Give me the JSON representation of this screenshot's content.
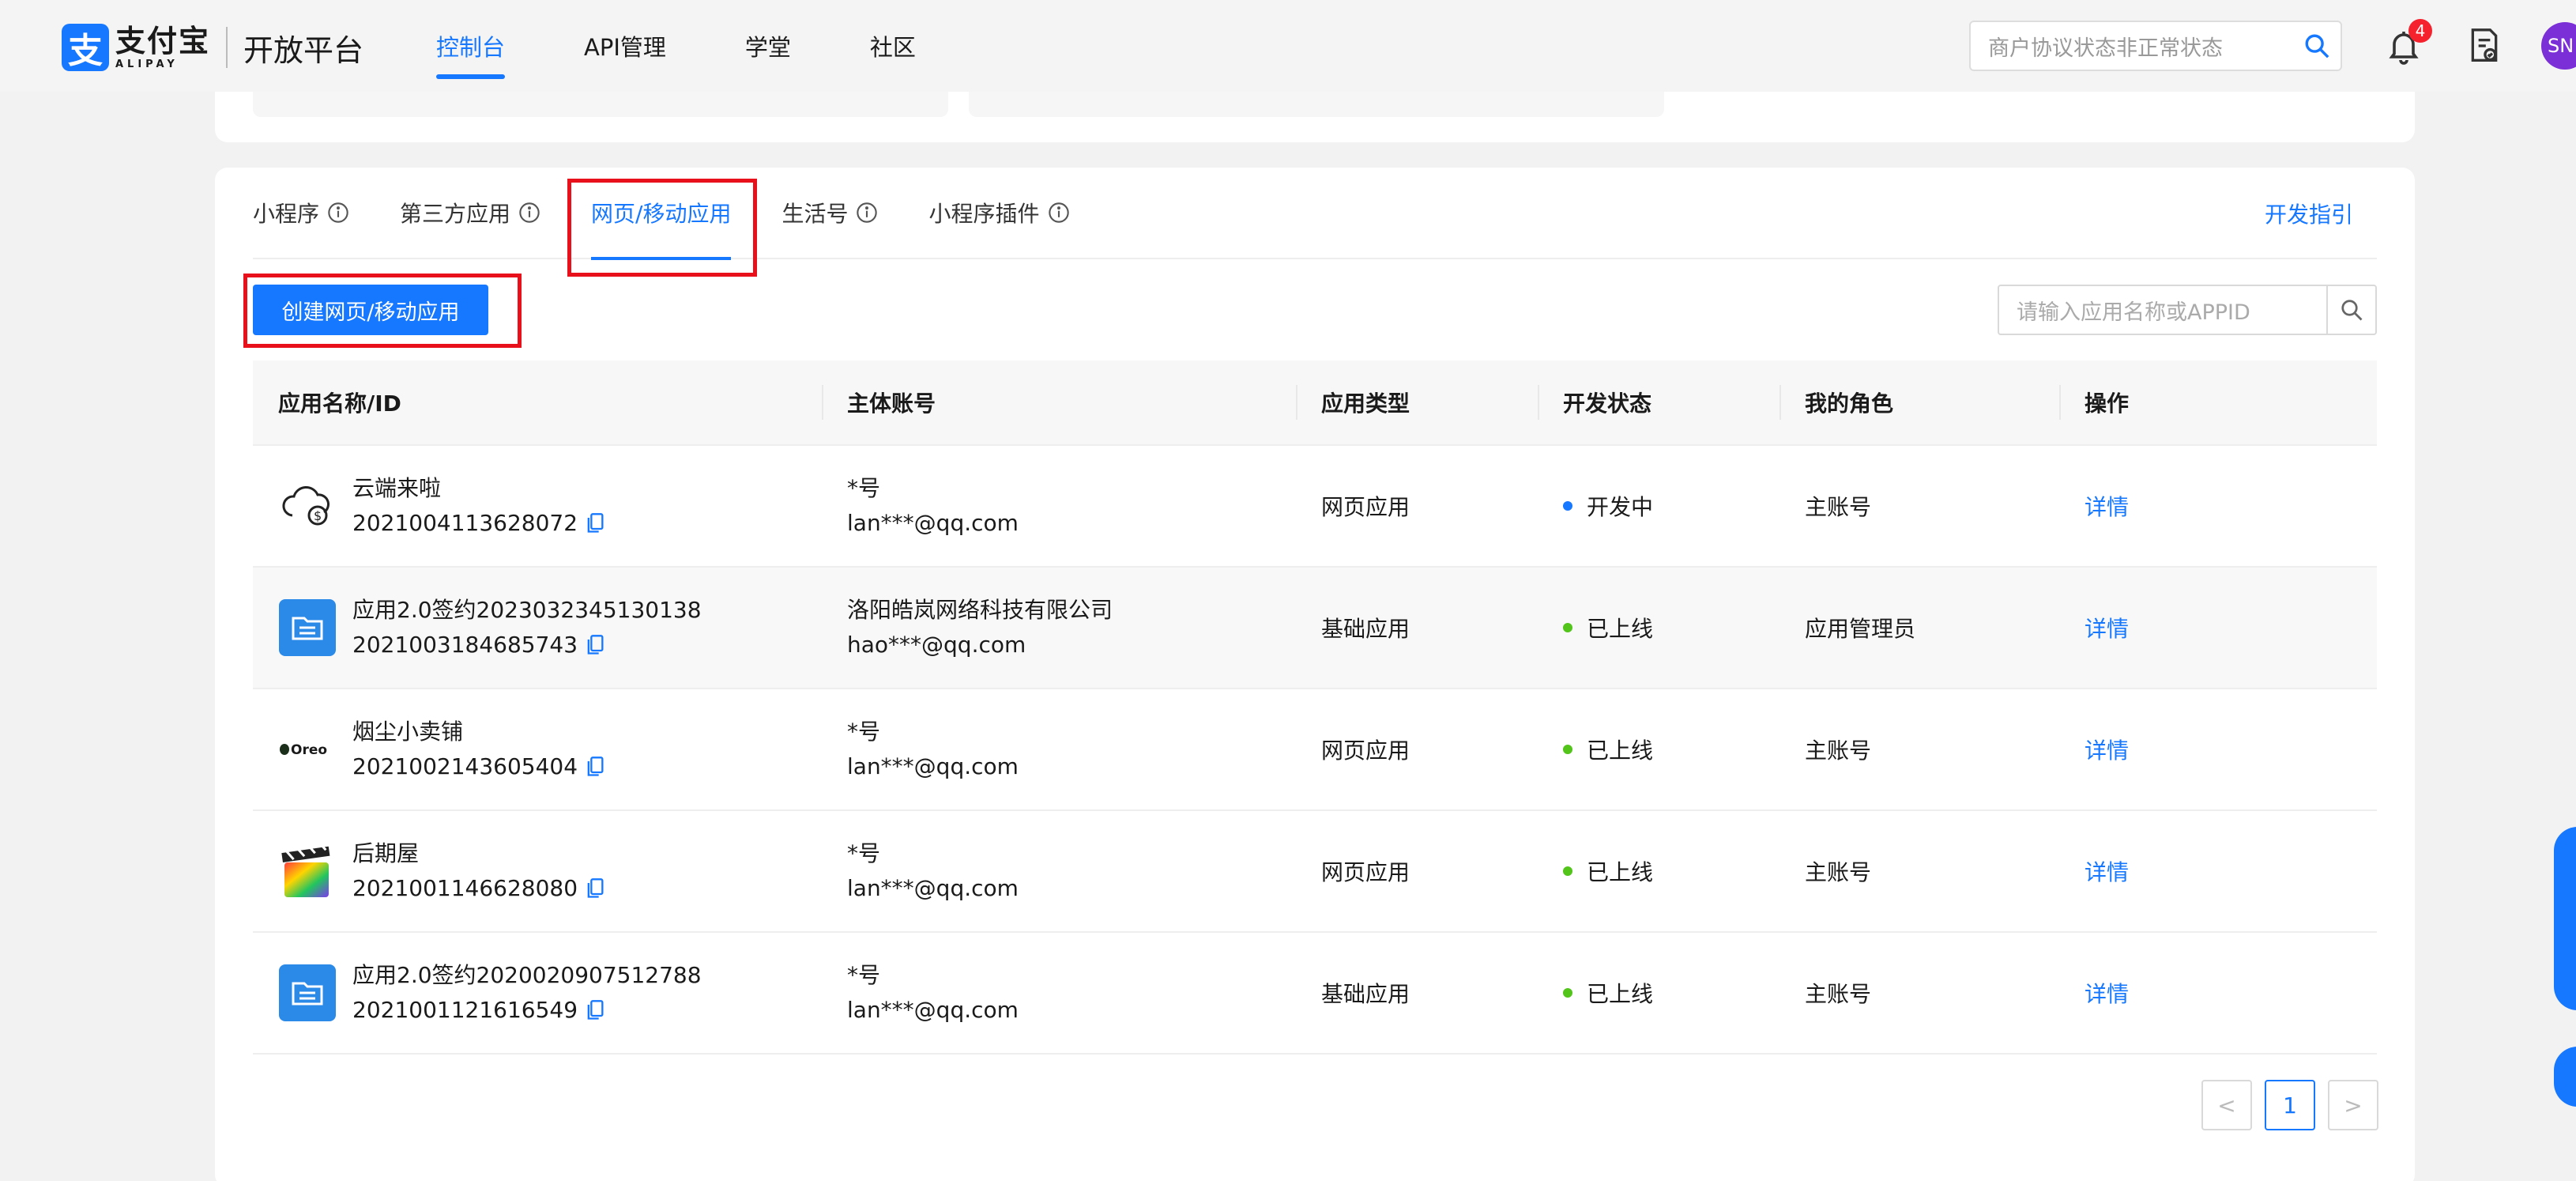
{
  "header": {
    "logo_cn": "支付宝",
    "logo_en": "ALIPAY",
    "platform": "开放平台",
    "nav": [
      {
        "label": "控制台",
        "active": true
      },
      {
        "label": "API管理",
        "active": false
      },
      {
        "label": "学堂",
        "active": false
      },
      {
        "label": "社区",
        "active": false
      }
    ],
    "search_text": "商户协议状态非正常状态",
    "notification_count": "4",
    "avatar_text": "SN"
  },
  "tabs": [
    {
      "label": "小程序",
      "info": true
    },
    {
      "label": "第三方应用",
      "info": true
    },
    {
      "label": "网页/移动应用",
      "info": false,
      "active": true
    },
    {
      "label": "生活号",
      "info": true
    },
    {
      "label": "小程序插件",
      "info": true
    }
  ],
  "dev_guide": "开发指引",
  "create_button": "创建网页/移动应用",
  "app_search_placeholder": "请输入应用名称或APPID",
  "table": {
    "headers": [
      "应用名称/ID",
      "主体账号",
      "应用类型",
      "开发状态",
      "我的角色",
      "操作"
    ],
    "rows": [
      {
        "icon": "cloud-dollar-icon",
        "name": "云端来啦",
        "id": "2021004113628072",
        "account_name": "*号",
        "account_email": "lan***@qq.com",
        "type": "网页应用",
        "status": "开发中",
        "status_color": "#1677ff",
        "role": "主账号",
        "action": "详情"
      },
      {
        "icon": "folder-app-icon",
        "name": "应用2.0签约2023032345130138",
        "id": "2021003184685743",
        "account_name": "洛阳皓岚网络科技有限公司",
        "account_email": "hao***@qq.com",
        "type": "基础应用",
        "status": "已上线",
        "status_color": "#52c41a",
        "role": "应用管理员",
        "action": "详情"
      },
      {
        "icon": "oreo-logo-icon",
        "name": "烟尘小卖铺",
        "id": "2021002143605404",
        "account_name": "*号",
        "account_email": "lan***@qq.com",
        "type": "网页应用",
        "status": "已上线",
        "status_color": "#52c41a",
        "role": "主账号",
        "action": "详情"
      },
      {
        "icon": "clapperboard-icon",
        "name": "后期屋",
        "id": "2021001146628080",
        "account_name": "*号",
        "account_email": "lan***@qq.com",
        "type": "网页应用",
        "status": "已上线",
        "status_color": "#52c41a",
        "role": "主账号",
        "action": "详情"
      },
      {
        "icon": "folder-app-icon",
        "name": "应用2.0签约2020020907512788",
        "id": "2021001121616549",
        "account_name": "*号",
        "account_email": "lan***@qq.com",
        "type": "基础应用",
        "status": "已上线",
        "status_color": "#52c41a",
        "role": "主账号",
        "action": "详情"
      }
    ]
  },
  "pagination": {
    "prev": "<",
    "current": "1",
    "next": ">"
  },
  "colors": {
    "accent": "#1677ff",
    "highlight_box": "#e8101a"
  }
}
